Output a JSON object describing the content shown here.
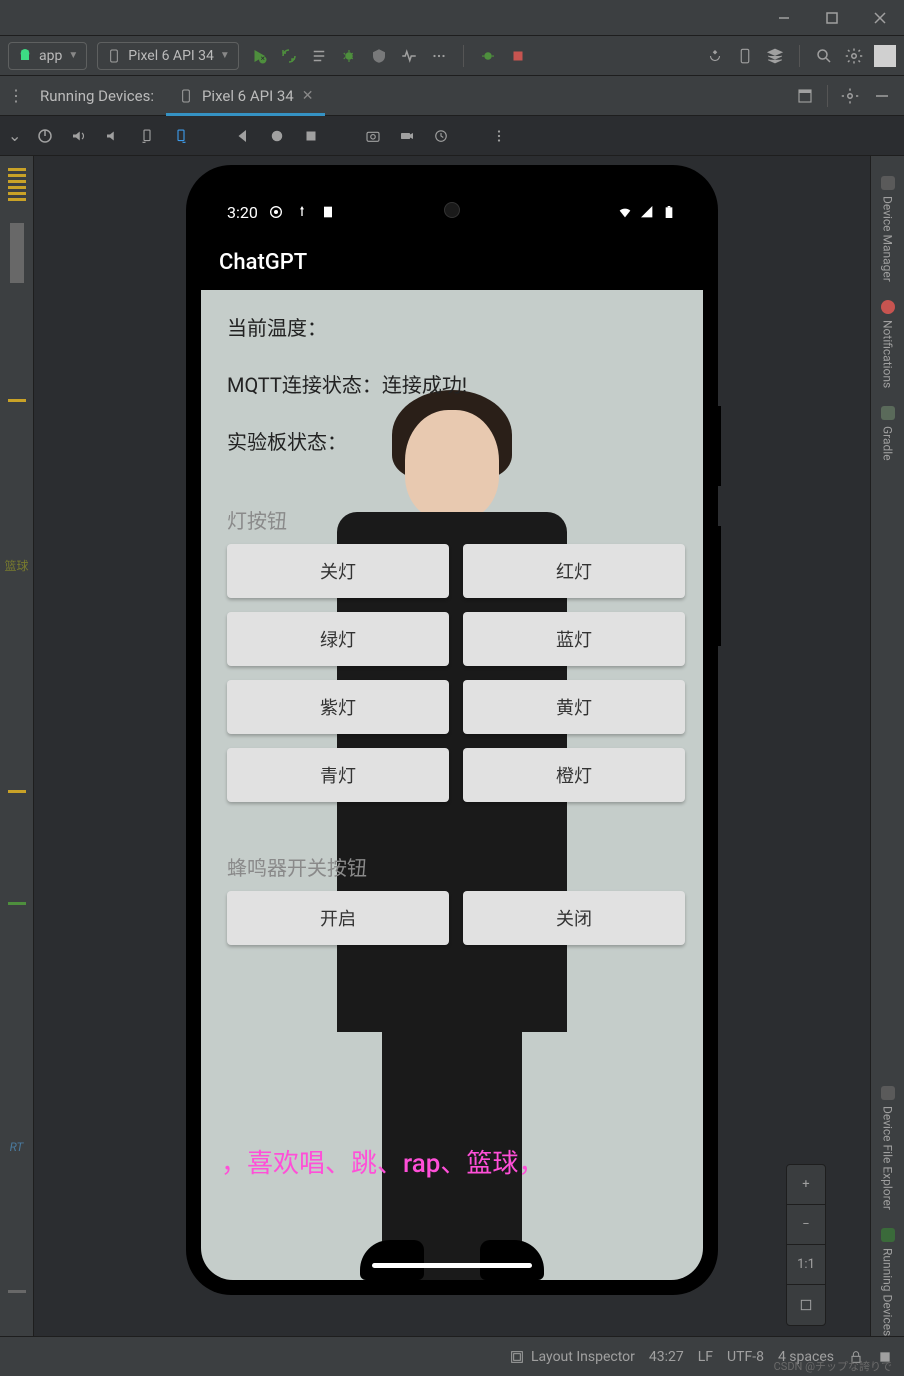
{
  "titlebar": {
    "minimize": "–",
    "maximize": "▢",
    "close": "✕"
  },
  "toolbar": {
    "module": "app",
    "device": "Pixel 6 API 34"
  },
  "tabs": {
    "running_label": "Running Devices:",
    "active_tab": "Pixel 6 API 34"
  },
  "right_panel": {
    "device_manager": "Device Manager",
    "notifications": "Notifications",
    "gradle": "Gradle",
    "device_explorer": "Device File Explorer",
    "running_devices": "Running Devices"
  },
  "left_panel": {
    "cn_text": "篮球",
    "it_text": "RT"
  },
  "zoom": {
    "fit": "1:1"
  },
  "status": {
    "layout_inspector": "Layout Inspector",
    "cursor": "43:27",
    "line_ending": "LF",
    "encoding": "UTF-8",
    "indent": "4 spaces",
    "watermark": "CSDN @チップな誇りで"
  },
  "phone": {
    "time": "3:20",
    "app_title": "ChatGPT",
    "temp_label": "当前温度：",
    "mqtt_label": "MQTT连接状态：连接成功!",
    "board_label": "实验板状态：",
    "lights_section": "灯按钮",
    "buzzer_section": "蜂鸣器开关按钮",
    "lights": [
      {
        "label": "关灯"
      },
      {
        "label": "红灯"
      },
      {
        "label": "绿灯"
      },
      {
        "label": "蓝灯"
      },
      {
        "label": "紫灯"
      },
      {
        "label": "黄灯"
      },
      {
        "label": "青灯"
      },
      {
        "label": "橙灯"
      }
    ],
    "buzzer": [
      {
        "label": "开启"
      },
      {
        "label": "关闭"
      }
    ],
    "marquee": "，喜欢唱、跳、rap、篮球，"
  }
}
